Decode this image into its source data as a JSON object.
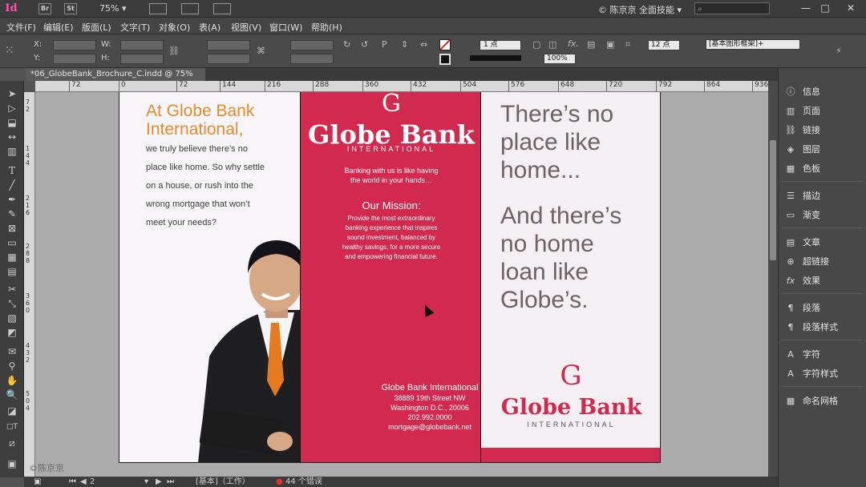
{
  "app": {
    "logo": "Id",
    "bridge_label": "Br",
    "stock_label": "St",
    "zoom": "75% ▾",
    "workspace": "© 陈京京  全面技能  ▾"
  },
  "menu": [
    "文件(F)",
    "编辑(E)",
    "版面(L)",
    "文字(T)",
    "对象(O)",
    "表(A)",
    "视图(V)",
    "窗口(W)",
    "帮助(H)"
  ],
  "control": {
    "x_label": "X:",
    "y_label": "Y:",
    "w_label": "W:",
    "h_label": "H:",
    "stroke_weight": "1 点",
    "opacity": "100%",
    "spacing": "12 点",
    "style": "[基本图形框架]+"
  },
  "document": {
    "tab_title": "*06_GlobeBank_Brochure_C.indd @ 75%",
    "close_glyph": "×"
  },
  "ruler": {
    "h_ticks": [
      "72",
      "0",
      "72",
      "144",
      "216",
      "288",
      "360",
      "432",
      "504",
      "576",
      "648",
      "720",
      "792",
      "864",
      "936"
    ],
    "v_ticks": [
      "7\n2",
      "1\n4\n4",
      "2\n1\n6",
      "2\n8\n8",
      "3\n6\n0",
      "4\n3\n2",
      "5\n0\n4"
    ]
  },
  "brochure": {
    "panel1": {
      "heading": "At Globe Bank International,",
      "body_lines": [
        "we truly believe there’s no",
        "place like home. So why settle",
        "on a house, or rush into the",
        "wrong mortgage that won’t",
        "meet your needs?"
      ]
    },
    "panel2": {
      "logo_letter": "G",
      "logo_name": "Globe Bank",
      "logo_sub": "INTERNATIONAL",
      "tagline_1": "Banking with us is like having",
      "tagline_2": "the world in your hands…",
      "mission_title": "Our Mission:",
      "mission_lines": [
        "Provide the most extraordinary",
        "banking experience that inspires",
        "sound investment, balanced by",
        "healthy savings, for a more secure",
        "and empowering financial future."
      ],
      "contact_lines": [
        "Globe Bank International",
        "38889 19th Street NW",
        "Washington D.C., 20006",
        "202.992.0000",
        "mortgage@globebank.net"
      ]
    },
    "panel3": {
      "headline_1": [
        "There’s no",
        "place like",
        "home..."
      ],
      "headline_2": [
        "And there’s",
        "no home",
        "loan like",
        "Globe’s."
      ],
      "logo_letter": "G",
      "logo_name": "Globe Bank",
      "logo_sub": "INTERNATIONAL"
    },
    "colors": {
      "brand_red": "#d2294e",
      "orange": "#e58a2b",
      "gray_text": "#6e6262"
    }
  },
  "status": {
    "page_num": "2",
    "mode": "[基本]（工作）",
    "errors": "44 个错误"
  },
  "watermark": "©陈京京",
  "panels": [
    {
      "icon": "info-icon",
      "label": "信息"
    },
    {
      "icon": "pages-icon",
      "label": "页面"
    },
    {
      "icon": "links-icon",
      "label": "链接"
    },
    {
      "icon": "layers-icon",
      "label": "图层"
    },
    {
      "icon": "swatches-icon",
      "label": "色板"
    },
    {
      "icon": "stroke-icon",
      "label": "描边"
    },
    {
      "icon": "gradient-icon",
      "label": "渐变"
    },
    {
      "icon": "article-icon",
      "label": "文章"
    },
    {
      "icon": "hyperlink-icon",
      "label": "超链接"
    },
    {
      "icon": "effects-icon",
      "label": "效果"
    },
    {
      "icon": "paragraph-icon",
      "label": "段落"
    },
    {
      "icon": "paragraph-style-icon",
      "label": "段落样式"
    },
    {
      "icon": "character-icon",
      "label": "字符"
    },
    {
      "icon": "character-style-icon",
      "label": "字符样式"
    },
    {
      "icon": "named-grid-icon",
      "label": "命名网格"
    }
  ]
}
